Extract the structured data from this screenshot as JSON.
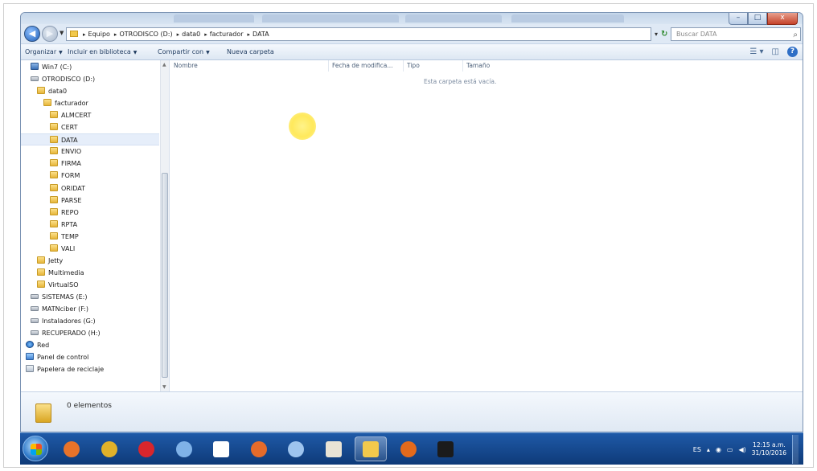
{
  "address": {
    "crumbs": [
      "Equipo",
      "OTRODISCO (D:)",
      "data0",
      "facturador",
      "DATA"
    ],
    "search_placeholder": "Buscar DATA"
  },
  "window": {
    "minimize": "–",
    "maximize": "□",
    "close": "x"
  },
  "toolbar": {
    "organize": "Organizar",
    "library": "Incluir en biblioteca",
    "share": "Compartir con",
    "new_folder": "Nueva carpeta"
  },
  "nav_tree": [
    {
      "label": "Win7 (C:)",
      "icon": "os-drive-icon",
      "indent": 0
    },
    {
      "label": "OTRODISCO (D:)",
      "icon": "drive-icon",
      "indent": 0
    },
    {
      "label": "data0",
      "icon": "folder-icon",
      "indent": 1
    },
    {
      "label": "facturador",
      "icon": "folder-icon",
      "indent": 2
    },
    {
      "label": "ALMCERT",
      "icon": "folder-icon",
      "indent": 3
    },
    {
      "label": "CERT",
      "icon": "folder-icon",
      "indent": 3
    },
    {
      "label": "DATA",
      "icon": "folder-icon",
      "indent": 3,
      "selected": true
    },
    {
      "label": "ENVIO",
      "icon": "folder-icon",
      "indent": 3
    },
    {
      "label": "FIRMA",
      "icon": "folder-icon",
      "indent": 3
    },
    {
      "label": "FORM",
      "icon": "folder-icon",
      "indent": 3
    },
    {
      "label": "ORIDAT",
      "icon": "folder-icon",
      "indent": 3
    },
    {
      "label": "PARSE",
      "icon": "folder-icon",
      "indent": 3
    },
    {
      "label": "REPO",
      "icon": "folder-icon",
      "indent": 3
    },
    {
      "label": "RPTA",
      "icon": "folder-icon",
      "indent": 3
    },
    {
      "label": "TEMP",
      "icon": "folder-icon",
      "indent": 3
    },
    {
      "label": "VALI",
      "icon": "folder-icon",
      "indent": 3
    },
    {
      "label": "Jetty",
      "icon": "folder-icon",
      "indent": 1
    },
    {
      "label": "Multimedia",
      "icon": "folder-icon",
      "indent": 1
    },
    {
      "label": "VirtualSO",
      "icon": "folder-icon",
      "indent": 1
    },
    {
      "label": "SISTEMAS (E:)",
      "icon": "drive-icon",
      "indent": 0
    },
    {
      "label": "MATNciber (F:)",
      "icon": "drive-icon",
      "indent": 0
    },
    {
      "label": "Instaladores (G:)",
      "icon": "drive-icon",
      "indent": 0
    },
    {
      "label": "RECUPERADO (H:)",
      "icon": "drive-icon",
      "indent": 0
    },
    {
      "label": "Red",
      "icon": "network-icon",
      "indent": -1
    },
    {
      "label": "Panel de control",
      "icon": "control-panel-icon",
      "indent": -1
    },
    {
      "label": "Papelera de reciclaje",
      "icon": "recycle-bin-icon",
      "indent": -1
    }
  ],
  "columns": [
    "Nombre",
    "Fecha de modifica...",
    "Tipo",
    "Tamaño"
  ],
  "empty_message": "Esta carpeta está vacía.",
  "details": {
    "count": "0 elementos"
  },
  "taskbar": {
    "apps": [
      {
        "name": "media-player-icon",
        "color": "#e8732a"
      },
      {
        "name": "chrome-icon",
        "color": "#e0b12a"
      },
      {
        "name": "opera-icon",
        "color": "#d8262c"
      },
      {
        "name": "app-blue-icon",
        "color": "#7fb2e8"
      },
      {
        "name": "postgres-icon",
        "color": "#ffffff"
      },
      {
        "name": "office-icon",
        "color": "#e56b2a"
      },
      {
        "name": "virtualbox-icon",
        "color": "#9ec4ee"
      },
      {
        "name": "java-icon",
        "color": "#e9e3d5"
      },
      {
        "name": "explorer-icon",
        "color": "#f2c94c"
      },
      {
        "name": "firefox-icon",
        "color": "#e36a1c"
      },
      {
        "name": "cmd-icon",
        "color": "#1b1b1b"
      }
    ],
    "lang": "ES",
    "time": "12:15 a.m.",
    "date": "31/10/2016"
  }
}
